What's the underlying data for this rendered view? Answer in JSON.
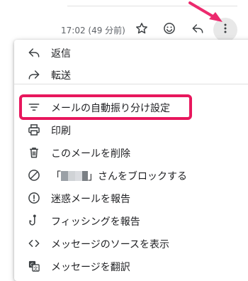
{
  "header": {
    "timestamp": "17:02 (49 分前)",
    "icons": [
      "star-icon",
      "emoji-icon",
      "reply-icon",
      "more-vert-icon"
    ]
  },
  "menu": {
    "items": [
      {
        "label": "返信",
        "icon": "reply-icon"
      },
      {
        "label": "転送",
        "icon": "forward-icon"
      },
      {
        "label": "メールの自動振り分け設定",
        "icon": "filter-icon"
      },
      {
        "label": "印刷",
        "icon": "print-icon"
      },
      {
        "label": "このメールを削除",
        "icon": "trash-icon"
      },
      {
        "label_prefix": "「",
        "label_suffix": "」さんをブロックする",
        "icon": "block-icon"
      },
      {
        "label": "迷惑メールを報告",
        "icon": "report-spam-icon"
      },
      {
        "label": "フィッシングを報告",
        "icon": "phishing-hook-icon"
      },
      {
        "label": "メッセージのソースを表示",
        "icon": "code-icon"
      },
      {
        "label": "メッセージを翻訳",
        "icon": "translate-icon"
      }
    ]
  },
  "colors": {
    "highlight": "#e8175d",
    "arrow": "#ec2a6e",
    "icon": "#3c4043",
    "text": "#202124",
    "muted": "#5f6368"
  }
}
